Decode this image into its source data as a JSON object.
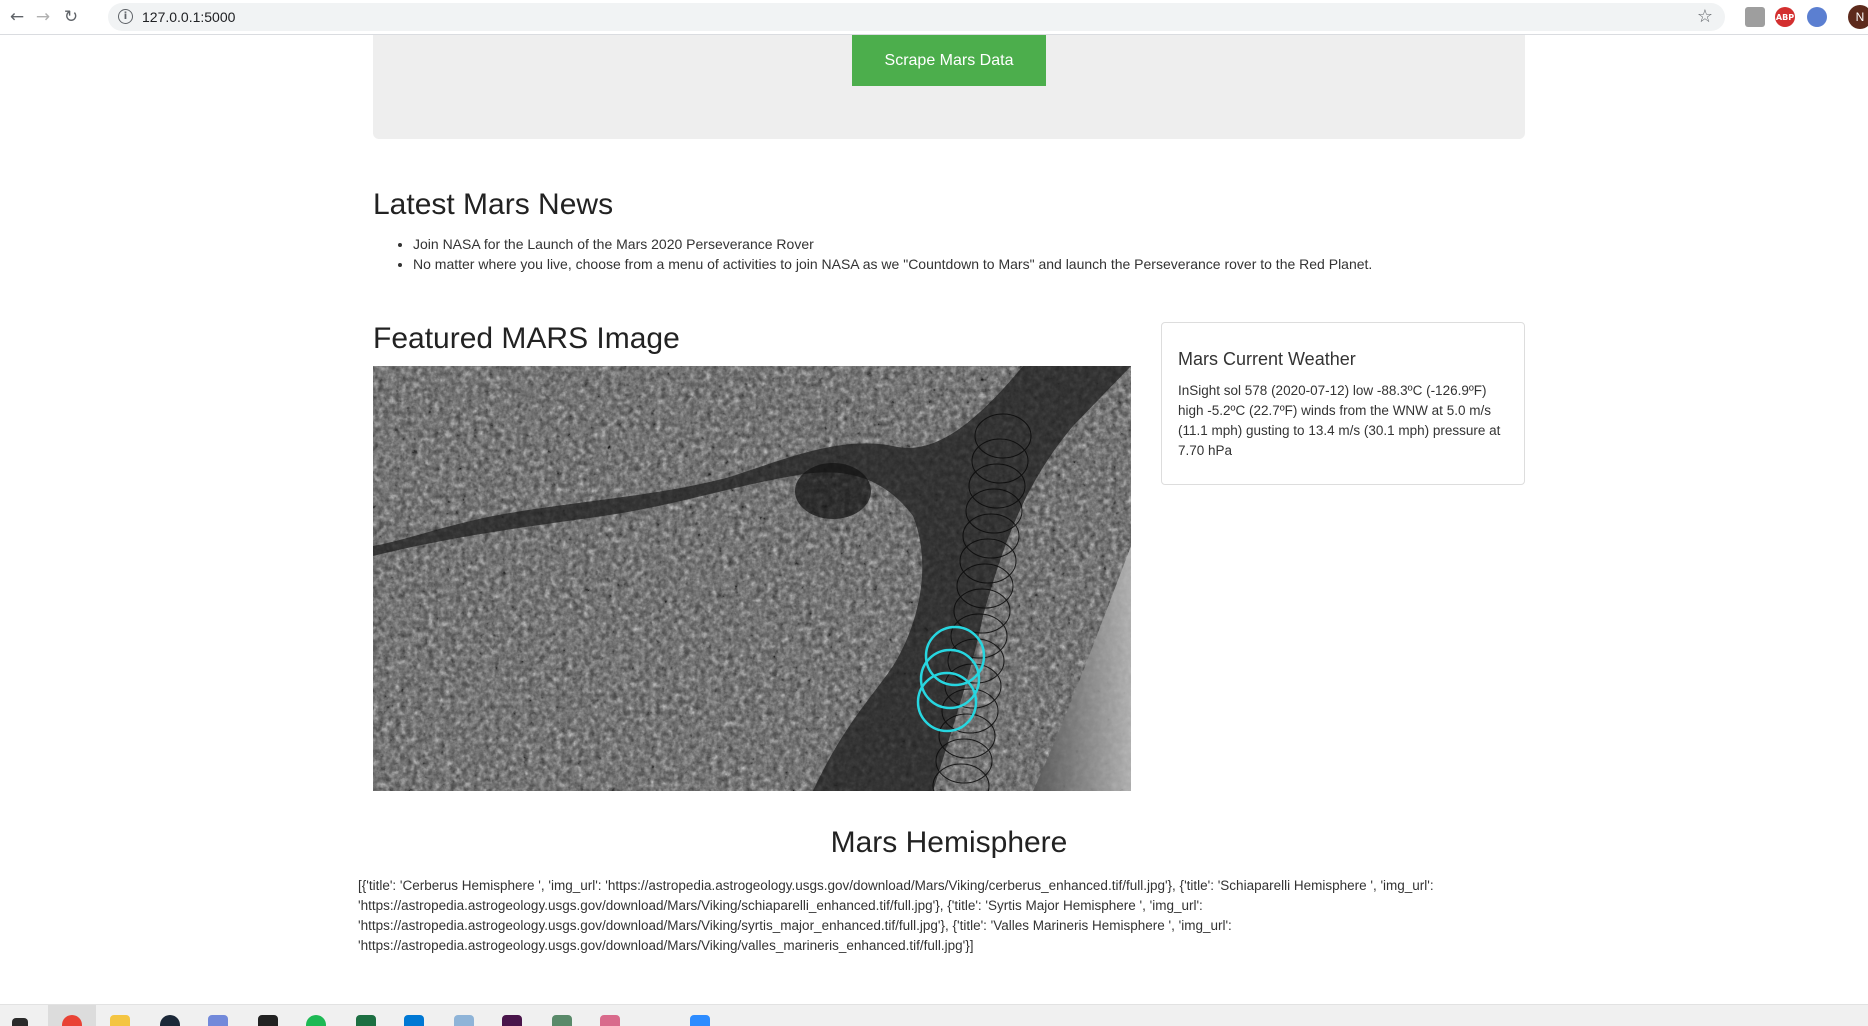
{
  "browser": {
    "url": "127.0.0.1:5000",
    "info_icon": "info-icon",
    "star_icon": "star-icon",
    "extensions": [
      {
        "name": "extension-icon-1",
        "label": ""
      },
      {
        "name": "adblock-icon",
        "label": "ABP",
        "color": "#d32f2f"
      },
      {
        "name": "extension-icon-3",
        "label": "",
        "color": "#5b7fd1"
      }
    ],
    "avatar_initial": "N"
  },
  "jumbotron": {
    "button_label": "Scrape Mars Data",
    "button_color": "#4cae4c"
  },
  "news": {
    "heading": "Latest Mars News",
    "items": [
      "Join NASA for the Launch of the Mars 2020 Perseverance Rover",
      "No matter where you live, choose from a menu of activities to join NASA as we \"Countdown to Mars\" and launch the Perseverance rover to the Red Planet."
    ]
  },
  "featured": {
    "heading": "Featured MARS Image"
  },
  "weather": {
    "title": "Mars Current Weather",
    "text": "InSight sol 578 (2020-07-12) low -88.3ºC (-126.9ºF) high -5.2ºC (22.7ºF) winds from the WNW at 5.0 m/s (11.1 mph) gusting to 13.4 m/s (30.1 mph) pressure at 7.70 hPa"
  },
  "hemisphere": {
    "heading": "Mars Hemisphere",
    "text": "[{'title': 'Cerberus Hemisphere ', 'img_url': 'https://astropedia.astrogeology.usgs.gov/download/Mars/Viking/cerberus_enhanced.tif/full.jpg'}, {'title': 'Schiaparelli Hemisphere ', 'img_url': 'https://astropedia.astrogeology.usgs.gov/download/Mars/Viking/schiaparelli_enhanced.tif/full.jpg'}, {'title': 'Syrtis Major Hemisphere ', 'img_url': 'https://astropedia.astrogeology.usgs.gov/download/Mars/Viking/syrtis_major_enhanced.tif/full.jpg'}, {'title': 'Valles Marineris Hemisphere ', 'img_url': 'https://astropedia.astrogeology.usgs.gov/download/Mars/Viking/valles_marineris_enhanced.tif/full.jpg'}]"
  },
  "taskbar": {
    "icons": [
      "windows-start-icon",
      "chrome-icon",
      "file-explorer-icon",
      "steam-icon",
      "discord-icon",
      "github-icon",
      "spotify-icon",
      "excel-icon",
      "vscode-icon",
      "paint-icon",
      "slack-icon",
      "app-icon",
      "app-icon-2",
      "zoom-icon"
    ]
  }
}
